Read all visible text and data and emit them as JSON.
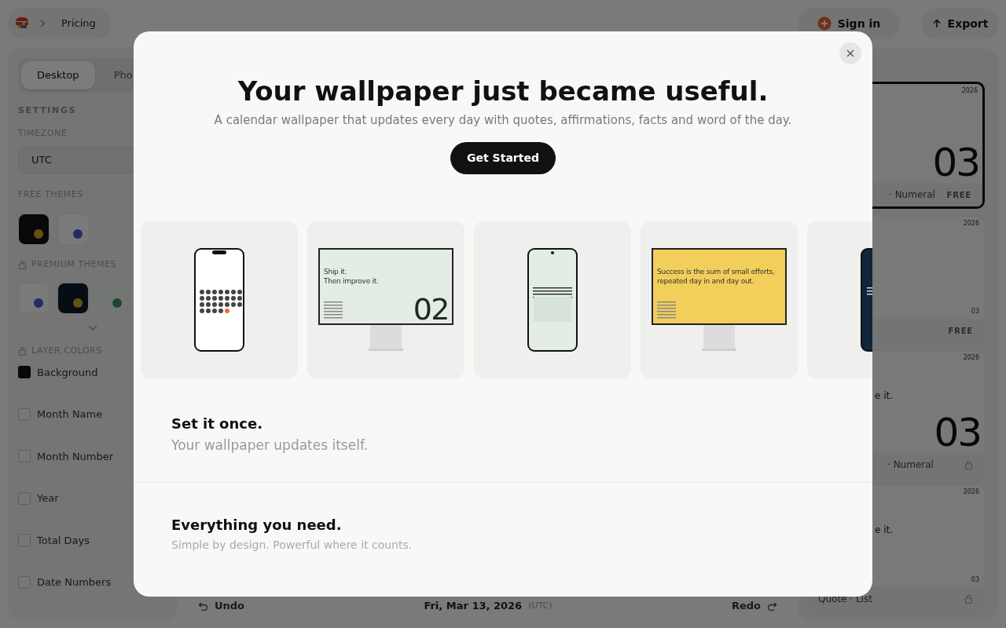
{
  "header": {
    "breadcrumb": "Pricing",
    "sign_in": "Sign in",
    "export": "Export"
  },
  "sidebar": {
    "tabs": [
      {
        "label": "Desktop",
        "selected": true
      },
      {
        "label": "Pho",
        "selected": false
      }
    ],
    "settings_heading": "SETTINGS",
    "timezone_label": "TIMEZONE",
    "timezone": "UTC",
    "free_themes_label": "FREE THEMES",
    "free_themes": [
      {
        "kind": "dark",
        "color": "#645114",
        "selected": false
      },
      {
        "kind": "light",
        "color": "#202d68",
        "selected": false
      }
    ],
    "premium_themes_label": "PREMIUM THEMES",
    "premium_themes": [
      {
        "kind": "light",
        "color": "#202d68",
        "selected": false
      },
      {
        "kind": "navy",
        "color": "#645114",
        "selected": false
      },
      {
        "kind": "mint",
        "color": "#1f4532",
        "selected": false
      }
    ],
    "layer_colors_label": "LAYER COLORS",
    "layers": [
      {
        "label": "Background",
        "checked": true
      },
      {
        "label": "Month Name",
        "checked": false
      },
      {
        "label": "Month Number",
        "checked": false
      },
      {
        "label": "Year",
        "checked": false
      },
      {
        "label": "Total Days",
        "checked": false
      },
      {
        "label": "Date Numbers",
        "checked": false
      }
    ]
  },
  "bottom_bar": {
    "undo": "Undo",
    "date": "Fri, Mar 13, 2026",
    "timezone": "(UTC)",
    "redo": "Redo"
  },
  "previews": [
    {
      "kind": "numeral",
      "year": "2026",
      "numeral": "03",
      "label": "· Numeral",
      "badge": "FREE",
      "locked": false,
      "selected": true
    },
    {
      "kind": "list",
      "year": "2026",
      "numeral": "03",
      "badge": "FREE",
      "locked": false,
      "selected": false
    },
    {
      "kind": "numeral",
      "year": "2026",
      "quote": "e it.",
      "numeral": "03",
      "label": "· Numeral",
      "locked": true,
      "selected": false
    },
    {
      "kind": "list",
      "year": "2026",
      "quote": "e it.",
      "numeral": "03",
      "label": "Quote · List",
      "locked": true,
      "selected": false
    }
  ],
  "modal": {
    "title": "Your wallpaper just became useful.",
    "subtitle": "A calendar wallpaper that updates every day with quotes, affirmations, facts and word of the day.",
    "button": "Get Started",
    "carousel": [
      {
        "kind": "phone-grid",
        "color": "#ffffff"
      },
      {
        "kind": "monitor",
        "color": "#e4ece6",
        "quote_lines": [
          "Ship it.",
          "Then improve it."
        ],
        "numeral": "02"
      },
      {
        "kind": "phone-list",
        "color": "#e4ece6"
      },
      {
        "kind": "monitor",
        "color": "#f2cf5b",
        "quote_lines": [
          "Success is the sum of small efforts,",
          "repeated day in and day out."
        ]
      },
      {
        "kind": "phone-dark",
        "color": "#10263a"
      }
    ],
    "features": [
      {
        "title": "Set it once.",
        "text": "Your wallpaper updates itself.",
        "kind": "headline"
      },
      {
        "title": "Everything you need.",
        "text": "Simple by design. Powerful where it counts.",
        "kind": "subsection"
      }
    ]
  }
}
